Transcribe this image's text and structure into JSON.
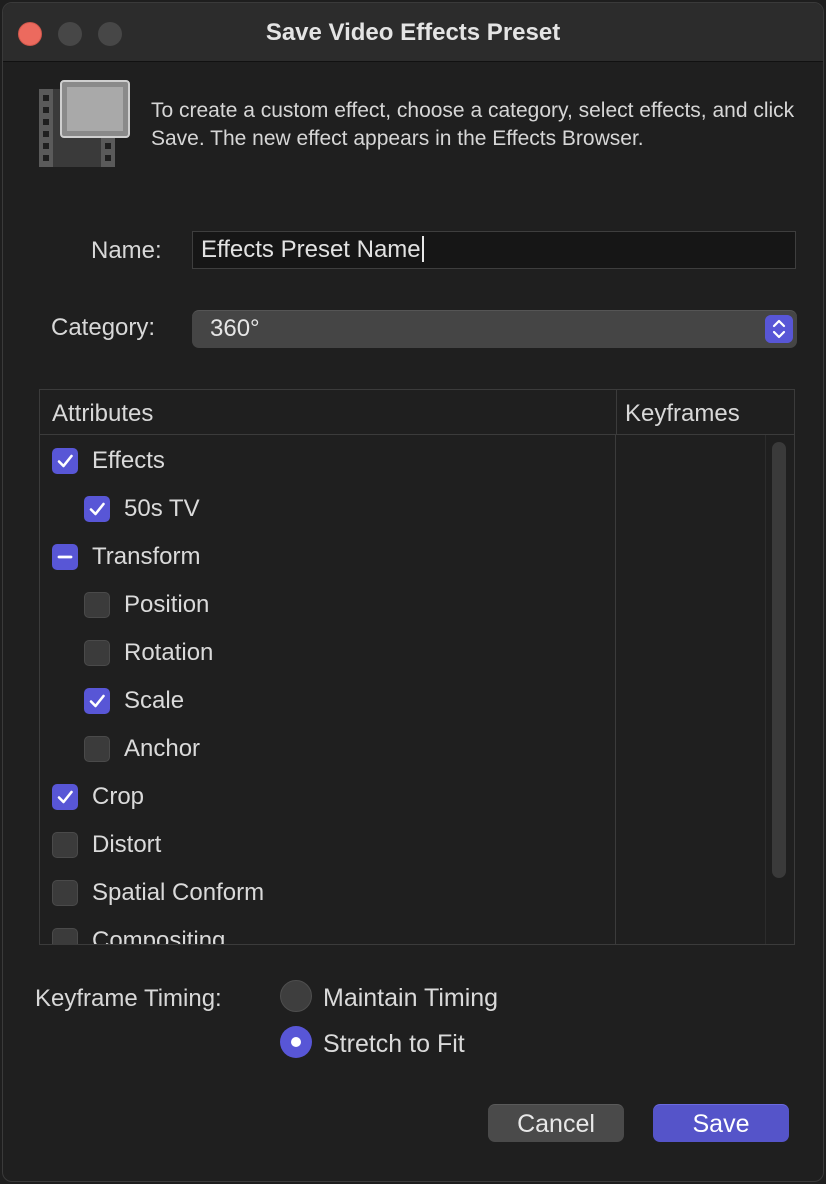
{
  "window": {
    "title": "Save Video Effects Preset",
    "intro_text": "To create a custom effect, choose a category, select effects, and click Save. The new effect appears in the Effects Browser."
  },
  "name": {
    "label": "Name:",
    "value": "Effects Preset Name"
  },
  "category": {
    "label": "Category:",
    "selected": "360°"
  },
  "table": {
    "columns": [
      "Attributes",
      "Keyframes"
    ],
    "rows": [
      {
        "label": "Effects",
        "state": "checked",
        "level": 0
      },
      {
        "label": "50s TV",
        "state": "checked",
        "level": 1
      },
      {
        "label": "Transform",
        "state": "mixed",
        "level": 0
      },
      {
        "label": "Position",
        "state": "unchecked",
        "level": 1
      },
      {
        "label": "Rotation",
        "state": "unchecked",
        "level": 1
      },
      {
        "label": "Scale",
        "state": "checked",
        "level": 1
      },
      {
        "label": "Anchor",
        "state": "unchecked",
        "level": 1
      },
      {
        "label": "Crop",
        "state": "checked",
        "level": 0
      },
      {
        "label": "Distort",
        "state": "unchecked",
        "level": 0
      },
      {
        "label": "Spatial Conform",
        "state": "unchecked",
        "level": 0
      },
      {
        "label": "Compositing",
        "state": "unchecked",
        "level": 0
      }
    ]
  },
  "keyframe_timing": {
    "label": "Keyframe Timing:",
    "options": [
      {
        "label": "Maintain Timing",
        "selected": false
      },
      {
        "label": "Stretch to Fit",
        "selected": true
      }
    ]
  },
  "buttons": {
    "cancel": "Cancel",
    "save": "Save"
  },
  "colors": {
    "accent": "#5856d6",
    "background": "#1f1f1f",
    "close": "#ec6a5e"
  }
}
